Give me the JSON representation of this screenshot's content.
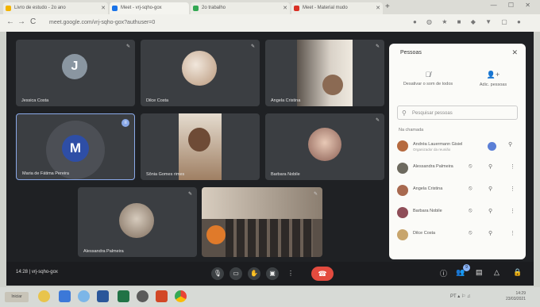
{
  "browser": {
    "tabs": [
      {
        "label": "Livro de estudo - 2o ano"
      },
      {
        "label": "Meet - vrj-sqho-gox"
      },
      {
        "label": "2o trabalho"
      },
      {
        "label": "Meet - Material mudo"
      }
    ],
    "new_tab": "+",
    "url": "meet.google.com/vrj-sqho-gox?authuser=0",
    "nav": {
      "back": "←",
      "forward": "→",
      "reload": "C"
    },
    "window_controls": "—  ☐  ✕"
  },
  "tiles": [
    {
      "name": "Jessica Costa",
      "initial": "J",
      "color": "#8a96a1"
    },
    {
      "name": "Dilce Costa",
      "color": "#c9b9a6"
    },
    {
      "name": "Angela Cristina",
      "color": "#6b5d54"
    },
    {
      "name": "Maria de Fátima Pereira",
      "initial": "M",
      "color": "#2e4ea6"
    },
    {
      "name": "Sônia Gomes rimes",
      "color": "#8b6f57"
    },
    {
      "name": "Barbara Nobile",
      "color": "#a47f72"
    },
    {
      "name": "Alessandra Palmeira",
      "color": "#9a8a7a"
    }
  ],
  "bottom_bar": {
    "time": "14:28",
    "separator": "|",
    "meeting_code": "vrj-sqho-gox",
    "mic_icon": "mic-icon",
    "camera_icon": "camera-icon",
    "hand_icon": "raise-hand-icon",
    "present_icon": "present-icon",
    "more_icon": "more-icon",
    "end_icon": "phone-end-icon",
    "participant_count": "9"
  },
  "panel": {
    "title": "Pessoas",
    "close": "✕",
    "action_mute_all": "Desativar o som de todos",
    "action_add": "Adic. pessoas",
    "search_placeholder": "Pesquisar pessoas",
    "section_label": "Na chamada",
    "people": [
      {
        "name": "Andréa Lauermann Gisiel",
        "subtitle": "Organizador da reunião",
        "color": "#b56a3f"
      },
      {
        "name": "Alessandra Palmeira",
        "color": "#6d6a5f"
      },
      {
        "name": "Angela Cristina",
        "color": "#a8694f"
      },
      {
        "name": "Barbara Nobile",
        "color": "#8f4e58"
      },
      {
        "name": "Dilce Costa",
        "color": "#c8a56c"
      }
    ]
  },
  "taskbar": {
    "start": "Iniciar",
    "tray": "PT ▴ ⚐ ♫",
    "time": "14:29",
    "date": "23/03/2021"
  }
}
